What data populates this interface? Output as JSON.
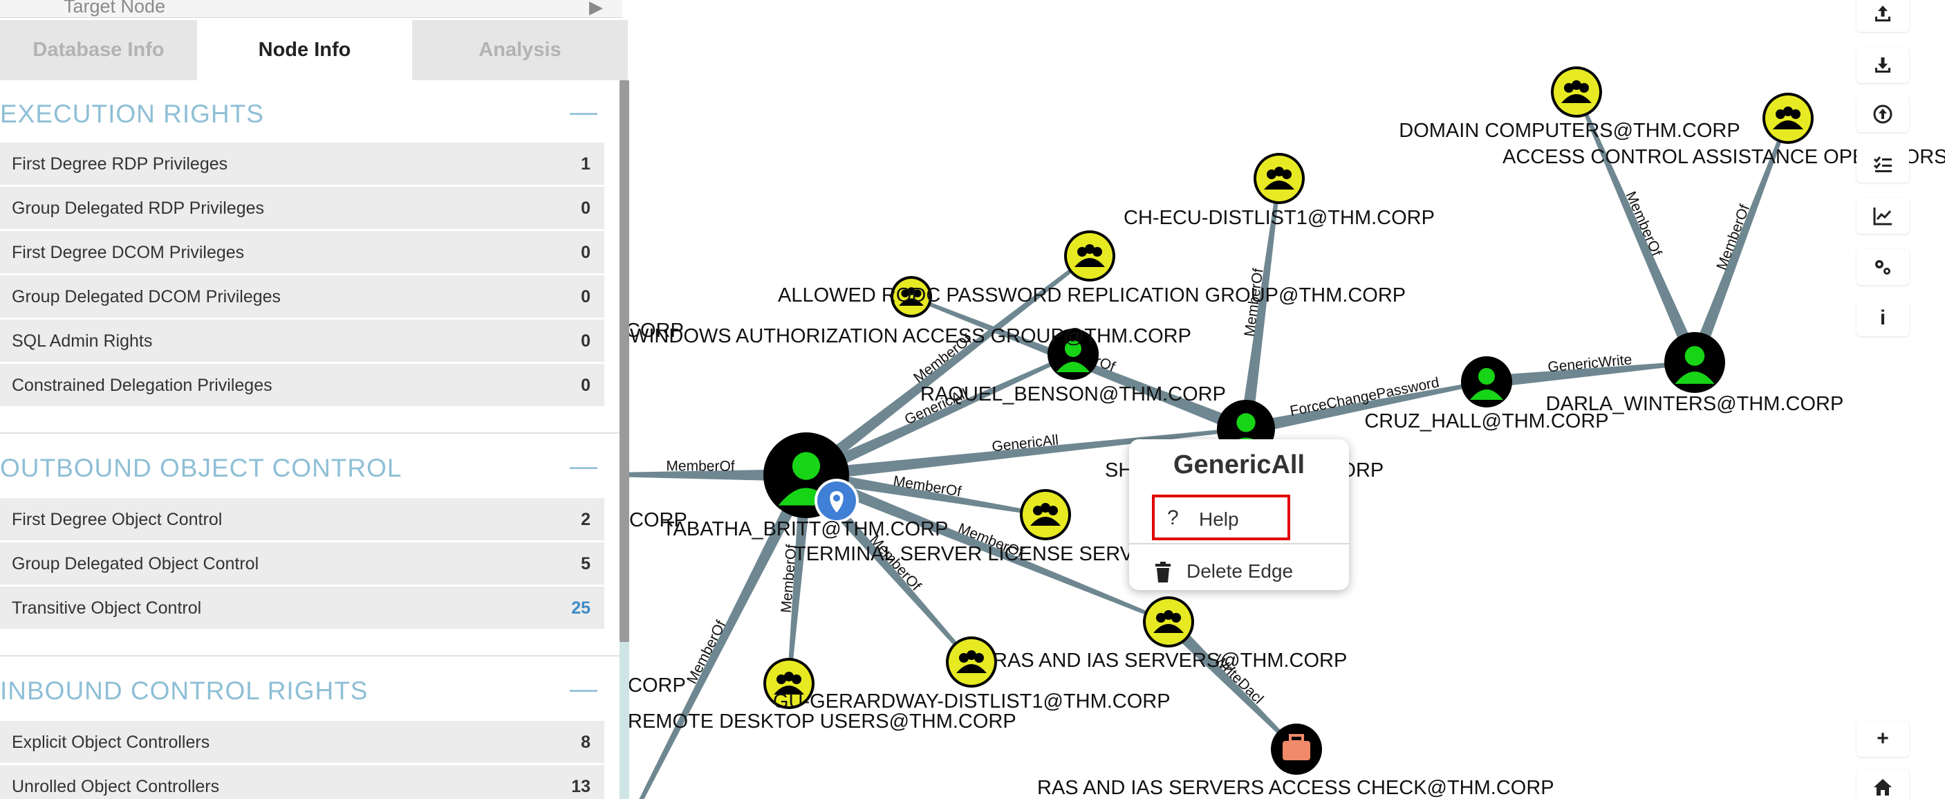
{
  "panel": {
    "target_node_label": "Target Node",
    "tabs": [
      {
        "label": "Database Info",
        "active": false
      },
      {
        "label": "Node Info",
        "active": true
      },
      {
        "label": "Analysis",
        "active": false
      }
    ],
    "sections": [
      {
        "title": "EXECUTION RIGHTS",
        "collapse_symbol": "—",
        "rows": [
          {
            "label": "First Degree RDP Privileges",
            "count": "1"
          },
          {
            "label": "Group Delegated RDP Privileges",
            "count": "0"
          },
          {
            "label": "First Degree DCOM Privileges",
            "count": "0"
          },
          {
            "label": "Group Delegated DCOM Privileges",
            "count": "0"
          },
          {
            "label": "SQL Admin Rights",
            "count": "0"
          },
          {
            "label": "Constrained Delegation Privileges",
            "count": "0"
          }
        ]
      },
      {
        "title": "OUTBOUND OBJECT CONTROL",
        "collapse_symbol": "—",
        "rows": [
          {
            "label": "First Degree Object Control",
            "count": "2"
          },
          {
            "label": "Group Delegated Object Control",
            "count": "5"
          },
          {
            "label": "Transitive Object Control",
            "count": "25"
          }
        ]
      },
      {
        "title": "INBOUND CONTROL RIGHTS",
        "collapse_symbol": "—",
        "rows": [
          {
            "label": "Explicit Object Controllers",
            "count": "8"
          },
          {
            "label": "Unrolled Object Controllers",
            "count": "13"
          }
        ]
      }
    ]
  },
  "graph": {
    "nodes": [
      {
        "id": "domain_computers",
        "label": "DOMAIN COMPUTERS@THM.CORP",
        "type": "group"
      },
      {
        "id": "access_control",
        "label": "ACCESS CONTROL ASSISTANCE OPERATORS",
        "type": "group"
      },
      {
        "id": "ch_ecu",
        "label": "CH-ECU-DISTLIST1@THM.CORP",
        "type": "group"
      },
      {
        "id": "allowed_rodc",
        "label": "ALLOWED RODC PASSWORD REPLICATION GROUP@THM.CORP",
        "type": "group"
      },
      {
        "id": "winauth",
        "label": "WINDOWS AUTHORIZATION ACCESS GROUP@THM.CORP",
        "type": "group"
      },
      {
        "id": "pw_group",
        "label": "",
        "type": "group"
      },
      {
        "id": "raquel",
        "label": "RAQUEL_BENSON@THM.CORP",
        "type": "user"
      },
      {
        "id": "shawna",
        "label": "SHAWNA_BRAY@THM.CORP",
        "type": "user"
      },
      {
        "id": "cruz",
        "label": "CRUZ_HALL@THM.CORP",
        "type": "user"
      },
      {
        "id": "darla",
        "label": "DARLA_WINTERS@THM.CORP",
        "type": "user"
      },
      {
        "id": "tabatha",
        "label": "TABATHA_BRITT@THM.CORP",
        "type": "user-owned"
      },
      {
        "id": "term_server",
        "label": "TERMINAL SERVER LICENSE SERVERS@THM.CORP",
        "type": "group"
      },
      {
        "id": "ras_ias",
        "label": "RAS AND IAS SERVERS@THM.CORP",
        "type": "group"
      },
      {
        "id": "ras_ias_check",
        "label": "RAS AND IAS SERVERS ACCESS CHECK@THM.CORP",
        "type": "container"
      },
      {
        "id": "gu_gerardway",
        "label": "GU-GERARDWAY-DISTLIST1@THM.CORP",
        "type": "group"
      },
      {
        "id": "remote_desktop",
        "label": "REMOTE DESKTOP USERS@THM.CORP",
        "type": "group"
      },
      {
        "id": "offscreen_a",
        "label": "CORP",
        "type": "offscreen"
      },
      {
        "id": "offscreen_b",
        "label": "CORP",
        "type": "offscreen"
      },
      {
        "id": "offscreen_c",
        "label": "CORP",
        "type": "offscreen"
      },
      {
        "id": "offscreen_d",
        "label": "",
        "type": "offscreen"
      },
      {
        "id": "offscreen_e",
        "label": "",
        "type": "offscreen"
      }
    ],
    "edges": [
      {
        "from": "darla",
        "to": "domain_computers",
        "label": "MemberOf"
      },
      {
        "from": "darla",
        "to": "access_control",
        "label": "MemberOf"
      },
      {
        "from": "cruz",
        "to": "darla",
        "label": "GenericWrite"
      },
      {
        "from": "shawna",
        "to": "cruz",
        "label": "ForceChangePassword"
      },
      {
        "from": "shawna",
        "to": "ch_ecu",
        "label": "MemberOf"
      },
      {
        "from": "shawna",
        "to": "pw_group",
        "label": "MemberOf"
      },
      {
        "from": "tabatha",
        "to": "shawna",
        "label": "GenericAll"
      },
      {
        "from": "tabatha",
        "to": "raquel",
        "label": "GenericAll"
      },
      {
        "from": "tabatha",
        "to": "allowed_rodc",
        "label": "MemberOf"
      },
      {
        "from": "tabatha",
        "to": "term_server",
        "label": "MemberOf"
      },
      {
        "from": "tabatha",
        "to": "ras_ias",
        "label": "MemberOf"
      },
      {
        "from": "tabatha",
        "to": "gu_gerardway",
        "label": "MemberOf"
      },
      {
        "from": "tabatha",
        "to": "remote_desktop",
        "label": "MemberOf"
      },
      {
        "from": "tabatha",
        "to": "offscreen_a",
        "label": "MemberOf"
      },
      {
        "from": "tabatha",
        "to": "offscreen_e",
        "label": "MemberOf"
      },
      {
        "from": "ras_ias",
        "to": "ras_ias_check",
        "label": "WriteDacl"
      }
    ]
  },
  "context_menu": {
    "title": "GenericAll",
    "help_icon": "?",
    "help_label": "Help",
    "delete_label": "Delete Edge"
  },
  "toolbar": {
    "buttons": [
      {
        "name": "upload-icon"
      },
      {
        "name": "download-icon"
      },
      {
        "name": "import-icon"
      },
      {
        "name": "checklist-icon"
      },
      {
        "name": "chart-icon"
      },
      {
        "name": "settings-icon"
      },
      {
        "name": "info-icon",
        "glyph": "i"
      },
      {
        "name": "zoom-in-icon",
        "glyph": "+"
      },
      {
        "name": "home-icon"
      }
    ]
  },
  "colors": {
    "edge": "#6f8791",
    "group_fill": "#e7ea23",
    "user_fill": "#17d417",
    "node_ring": "#000000",
    "container_fill": "#f08a6a",
    "section_title": "#8ebfd6",
    "row_bg": "#ececec",
    "count_highlight": "#3f8bc6",
    "highlight_border": "#e00000",
    "owned_badge": "#3f7fd6"
  }
}
